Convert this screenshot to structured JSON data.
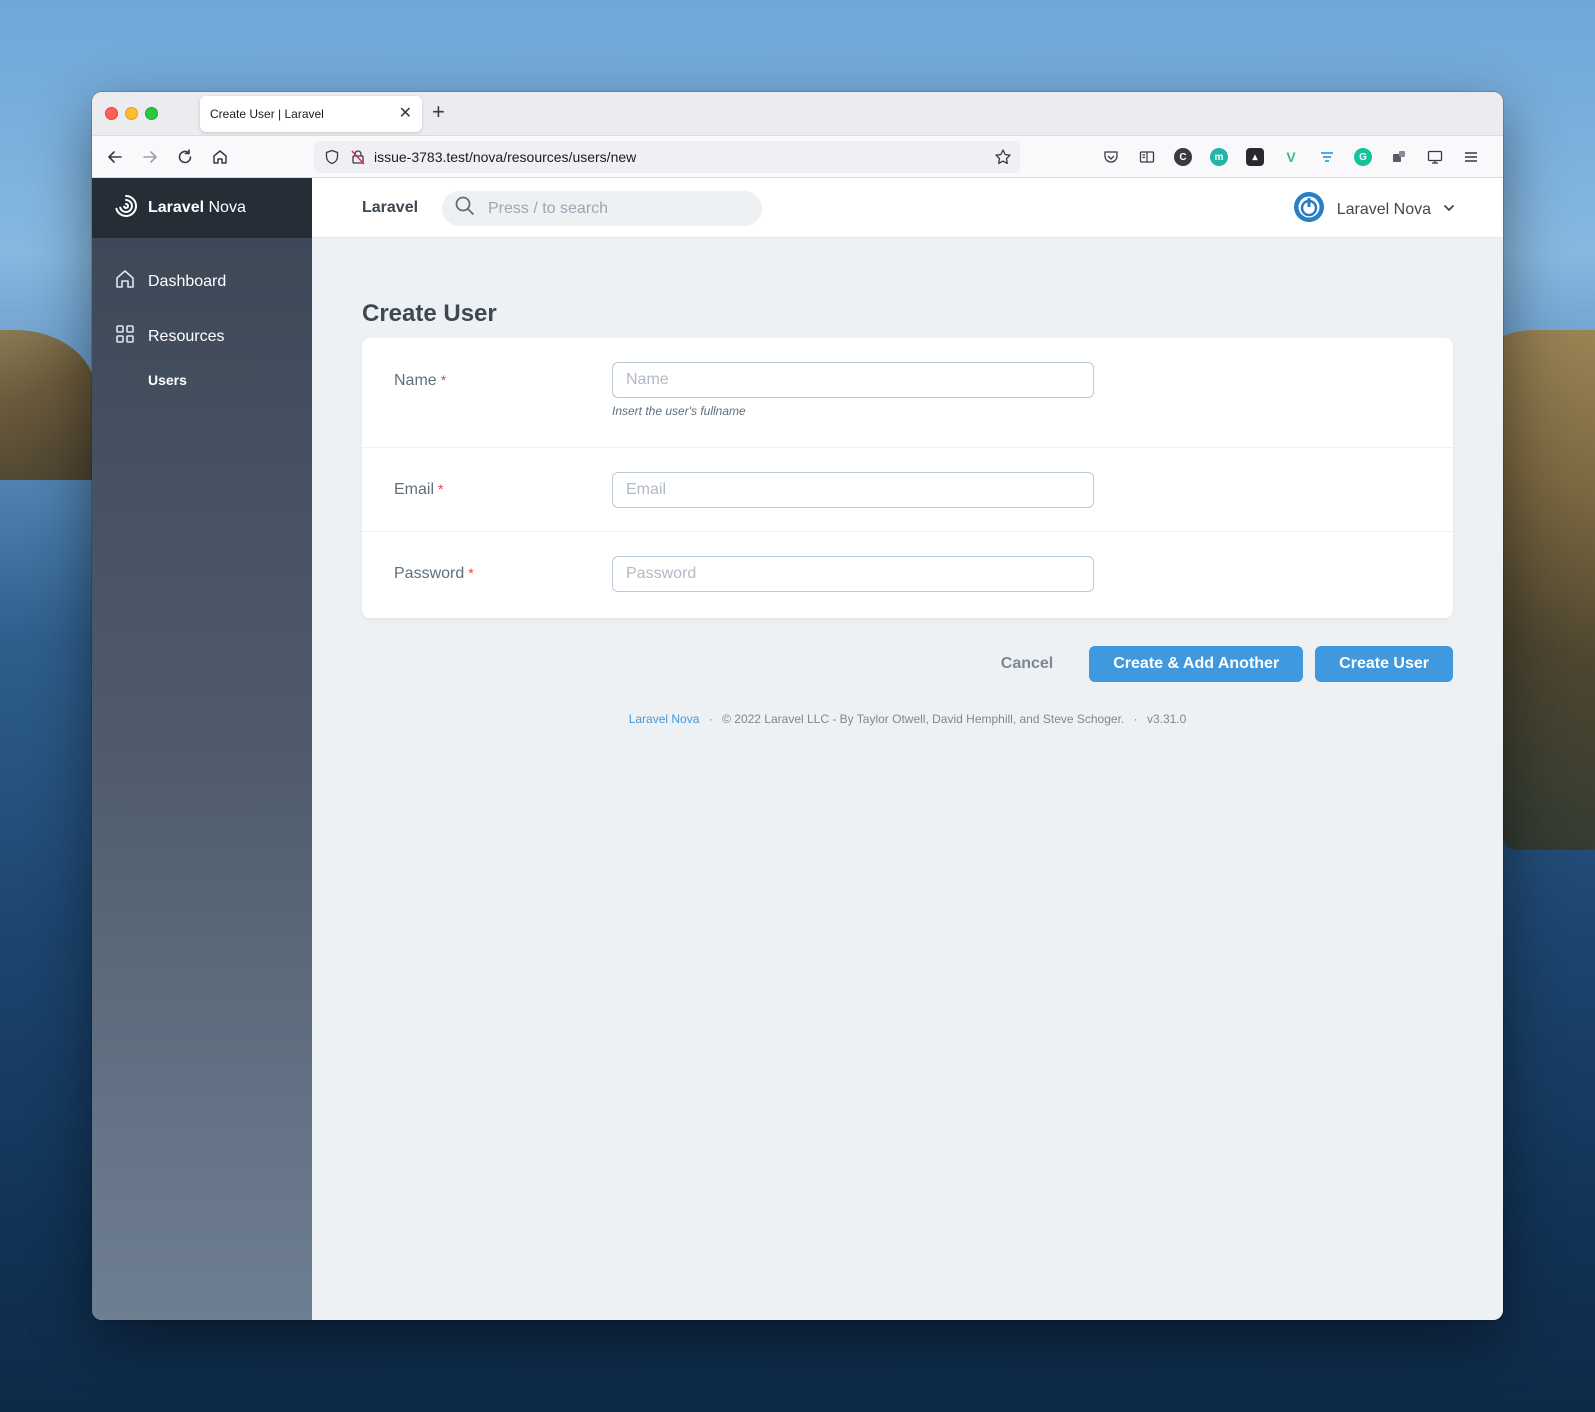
{
  "browser": {
    "tab_title": "Create User | Laravel",
    "tab_close": "✕",
    "new_tab": "+",
    "url": "issue-3783.test/nova/resources/users/new"
  },
  "sidebar": {
    "brand_bold": "Laravel",
    "brand_light": "Nova",
    "items": [
      {
        "label": "Dashboard",
        "icon": "home-icon"
      },
      {
        "label": "Resources",
        "icon": "grid-icon"
      }
    ],
    "sub_items": [
      {
        "label": "Users"
      }
    ]
  },
  "topbar": {
    "app_name": "Laravel",
    "search_placeholder": "Press / to search",
    "user_name": "Laravel Nova"
  },
  "main": {
    "title": "Create User",
    "fields": [
      {
        "label": "Name",
        "required": "*",
        "placeholder": "Name",
        "value": "",
        "help": "Insert the user's fullname"
      },
      {
        "label": "Email",
        "required": "*",
        "placeholder": "Email",
        "value": ""
      },
      {
        "label": "Password",
        "required": "*",
        "placeholder": "Password",
        "value": ""
      }
    ],
    "buttons": {
      "cancel": "Cancel",
      "create_another": "Create & Add Another",
      "create": "Create User"
    }
  },
  "footer": {
    "link": "Laravel Nova",
    "sep": "·",
    "copyright": "© 2022 Laravel LLC - By Taylor Otwell, David Hemphill, and Steve Schoger.",
    "version": "v3.31.0"
  },
  "colors": {
    "accent": "#4099de",
    "sidebar_dark": "#252d37",
    "required": "#e74444"
  }
}
